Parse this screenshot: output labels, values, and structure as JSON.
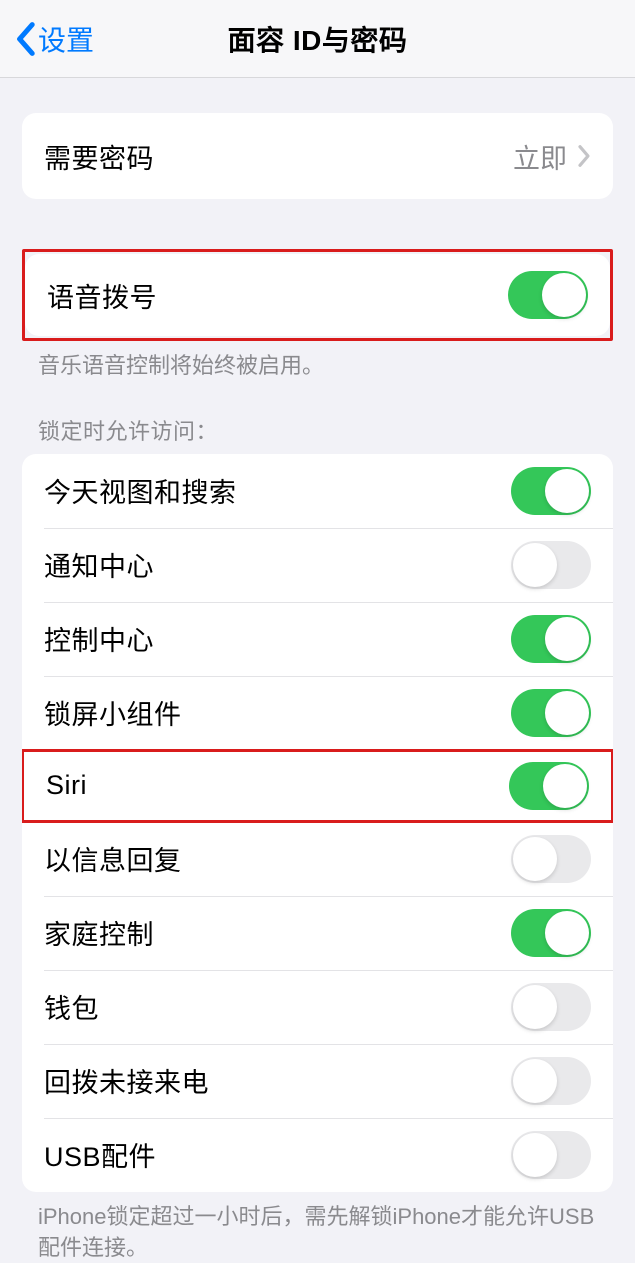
{
  "header": {
    "back_label": "设置",
    "title": "面容 ID与密码"
  },
  "section_require": {
    "label": "需要密码",
    "value": "立即"
  },
  "section_voice": {
    "label": "语音拨号",
    "enabled": true,
    "footer": "音乐语音控制将始终被启用。"
  },
  "section_locked": {
    "header": "锁定时允许访问：",
    "items": [
      {
        "label": "今天视图和搜索",
        "enabled": true
      },
      {
        "label": "通知中心",
        "enabled": false
      },
      {
        "label": "控制中心",
        "enabled": true
      },
      {
        "label": "锁屏小组件",
        "enabled": true
      },
      {
        "label": "Siri",
        "enabled": true
      },
      {
        "label": "以信息回复",
        "enabled": false
      },
      {
        "label": "家庭控制",
        "enabled": true
      },
      {
        "label": "钱包",
        "enabled": false
      },
      {
        "label": "回拨未接来电",
        "enabled": false
      },
      {
        "label": "USB配件",
        "enabled": false
      }
    ],
    "footer": "iPhone锁定超过一小时后，需先解锁iPhone才能允许USB配件连接。"
  }
}
